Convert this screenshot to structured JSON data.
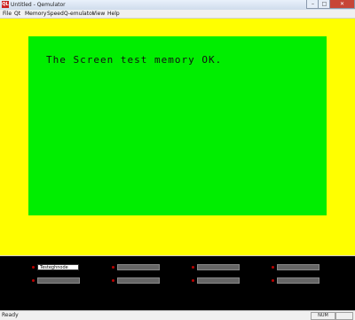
{
  "window": {
    "title": "Untitled - Qemulator",
    "icon_text": "QL",
    "controls": {
      "minimize": "–",
      "maximize": "□",
      "close": "✕"
    }
  },
  "menu": {
    "items": [
      "File",
      "Qt",
      "Memory",
      "Speed",
      "Q-emulator",
      "View",
      "Help"
    ]
  },
  "display": {
    "message": "The Screen test memory OK.",
    "border_color": "#ffff00",
    "screen_color": "#00ee00"
  },
  "panel": {
    "slots": [
      {
        "value": "Testeghnode",
        "active": true
      },
      {
        "value": "",
        "active": false
      },
      {
        "value": "",
        "active": false
      },
      {
        "value": "",
        "active": false
      },
      {
        "value": "",
        "active": false
      },
      {
        "value": "",
        "active": false
      },
      {
        "value": "",
        "active": false
      },
      {
        "value": "",
        "active": false
      }
    ]
  },
  "status": {
    "text": "Ready",
    "cells": [
      "NUM",
      ""
    ]
  }
}
